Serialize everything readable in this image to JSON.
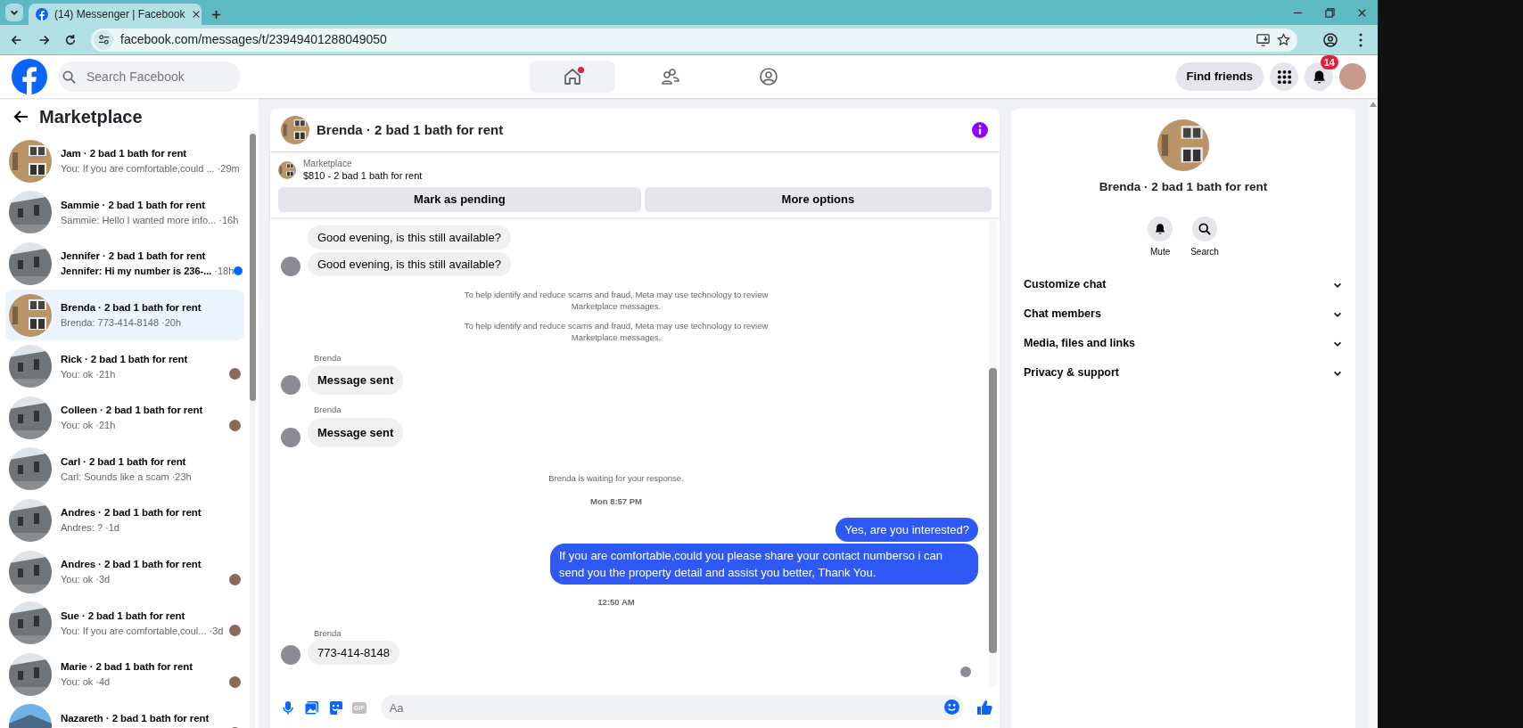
{
  "browser": {
    "tab_title": "(14) Messenger | Facebook",
    "url": "facebook.com/messages/t/23949401288049050"
  },
  "header": {
    "search": {
      "placeholder": "Search Facebook"
    },
    "nav": [
      {
        "kind": "home",
        "selected": true,
        "dot": true
      },
      {
        "kind": "friends",
        "selected": false,
        "dot": false
      },
      {
        "kind": "groups",
        "selected": false,
        "dot": false
      }
    ],
    "find_friends": "Find friends",
    "notification_count": "14"
  },
  "sidebar": {
    "title": "Marketplace",
    "conversations": [
      {
        "name": "Jam · 2 bad 1 bath for rent",
        "preview": "You: If you are comfortable,could ...",
        "time": "·29m",
        "kind": "brick",
        "unread": false,
        "seen": false,
        "selected": false
      },
      {
        "name": "Sammie · 2 bad 1 bath for rent",
        "preview": "Sammie: Hello I wanted more info...",
        "time": "·16h",
        "kind": "siding",
        "unread": false,
        "seen": false,
        "selected": false
      },
      {
        "name": "Jennifer · 2 bad 1 bath for rent",
        "preview": "Jennifer: Hi my number is 236-...",
        "time": "·18h",
        "kind": "siding",
        "unread": true,
        "seen": false,
        "selected": false
      },
      {
        "name": "Brenda · 2 bad 1 bath for rent",
        "preview": "Brenda: 773-414-8148",
        "time": "·20h",
        "kind": "brick",
        "unread": false,
        "seen": false,
        "selected": true
      },
      {
        "name": "Rick · 2 bad 1 bath for rent",
        "preview": "You: ok",
        "time": "·21h",
        "kind": "siding",
        "unread": false,
        "seen": true,
        "selected": false
      },
      {
        "name": "Colleen · 2 bad 1 bath for rent",
        "preview": "You: ok",
        "time": "·21h",
        "kind": "siding",
        "unread": false,
        "seen": true,
        "selected": false
      },
      {
        "name": "Carl · 2 bad 1 bath for rent",
        "preview": "Carl: Sounds like a scam",
        "time": "·23h",
        "kind": "siding",
        "unread": false,
        "seen": false,
        "selected": false
      },
      {
        "name": "Andres · 2 bad 1 bath for rent",
        "preview": "Andres: ?",
        "time": "·1d",
        "kind": "siding",
        "unread": false,
        "seen": false,
        "selected": false
      },
      {
        "name": "Andres · 2 bad 1 bath for rent",
        "preview": "You: ok",
        "time": "·3d",
        "kind": "siding",
        "unread": false,
        "seen": true,
        "selected": false
      },
      {
        "name": "Sue · 2 bad 1 bath for rent",
        "preview": "You: If you are comfortable,coul...",
        "time": "·3d",
        "kind": "siding",
        "unread": false,
        "seen": true,
        "selected": false
      },
      {
        "name": "Marie · 2 bad 1 bath for rent",
        "preview": "You: ok",
        "time": "·4d",
        "kind": "siding",
        "unread": false,
        "seen": true,
        "selected": false
      },
      {
        "name": "Nazareth · 2 bad 1 bath for rent",
        "kind": "sky",
        "unread": false,
        "seen": true,
        "selected": false
      }
    ]
  },
  "chat": {
    "title": "Brenda · 2 bad 1 bath for rent",
    "listing_label": "Marketplace",
    "listing": "$810 - 2 bad 1 bath for rent",
    "buttons": [
      "Mark as pending",
      "More options"
    ],
    "messages": [
      {
        "kind": "incoming",
        "text": "Good evening, is this still available?",
        "avatar": false,
        "bold": false
      },
      {
        "kind": "incoming",
        "text": "Good evening, is this still available?",
        "avatar": true,
        "bold": false
      },
      {
        "kind": "notice",
        "text": "To help identify and reduce scams and fraud, Meta may use technology to review Marketplace messages."
      },
      {
        "kind": "notice",
        "text": "To help identify and reduce scams and fraud, Meta may use technology to review Marketplace messages."
      },
      {
        "kind": "sender",
        "text": "Brenda"
      },
      {
        "kind": "incoming",
        "text": "Message sent",
        "avatar": true,
        "bold": true
      },
      {
        "kind": "sender",
        "text": "Brenda"
      },
      {
        "kind": "incoming",
        "text": "Message sent",
        "avatar": true,
        "bold": true
      },
      {
        "kind": "notice",
        "text": "Brenda is waiting for your response."
      },
      {
        "kind": "timestamp",
        "text": "Mon 8:57 PM"
      },
      {
        "kind": "outgoing",
        "text": "Yes, are you interested?"
      },
      {
        "kind": "outgoing",
        "text": "If you are comfortable,could you please share your contact numberso i can send you the property detail and assist you better, Thank You."
      },
      {
        "kind": "timestamp",
        "text": "12:50 AM"
      },
      {
        "kind": "sender",
        "text": "Brenda"
      },
      {
        "kind": "incoming",
        "text": "773-414-8148",
        "avatar": true,
        "bold": false
      }
    ],
    "read_receipt": true,
    "composer": {
      "gif_label": "GIF",
      "placeholder": "Aa"
    }
  },
  "details": {
    "name": "Brenda · 2 bad 1 bath for rent",
    "actions": [
      {
        "kind": "mute",
        "label": "Mute"
      },
      {
        "kind": "search",
        "label": "Search"
      }
    ],
    "sections": [
      {
        "label": "Customize chat",
        "expanded": false
      },
      {
        "label": "Chat members",
        "expanded": false
      },
      {
        "label": "Media, files and links",
        "expanded": false
      },
      {
        "label": "Privacy & support",
        "expanded": false
      }
    ]
  }
}
